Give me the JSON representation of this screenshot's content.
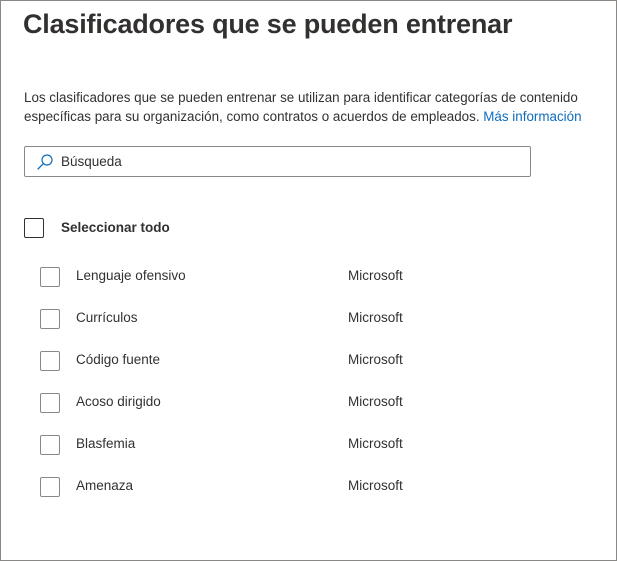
{
  "panel": {
    "title": "Clasificadores que se pueden entrenar",
    "description": "Los clasificadores que se pueden entrenar se utilizan para identificar categorías de contenido específicas para su organización, como contratos o acuerdos de empleados.",
    "more_info_link": "Más información"
  },
  "search": {
    "placeholder": "Búsqueda",
    "value": "",
    "icon": "search-icon"
  },
  "select_all": {
    "label": "Seleccionar todo",
    "checked": false
  },
  "classifiers": [
    {
      "name": "Lenguaje ofensivo",
      "publisher": "Microsoft",
      "checked": false
    },
    {
      "name": "Currículos",
      "publisher": "Microsoft",
      "checked": false
    },
    {
      "name": "Código fuente",
      "publisher": "Microsoft",
      "checked": false
    },
    {
      "name": "Acoso dirigido",
      "publisher": "Microsoft",
      "checked": false
    },
    {
      "name": "Blasfemia",
      "publisher": "Microsoft",
      "checked": false
    },
    {
      "name": "Amenaza",
      "publisher": "Microsoft",
      "checked": false
    }
  ],
  "colors": {
    "text": "#323130",
    "link": "#0f6cbd",
    "border": "#8a8886",
    "background": "#ffffff"
  }
}
